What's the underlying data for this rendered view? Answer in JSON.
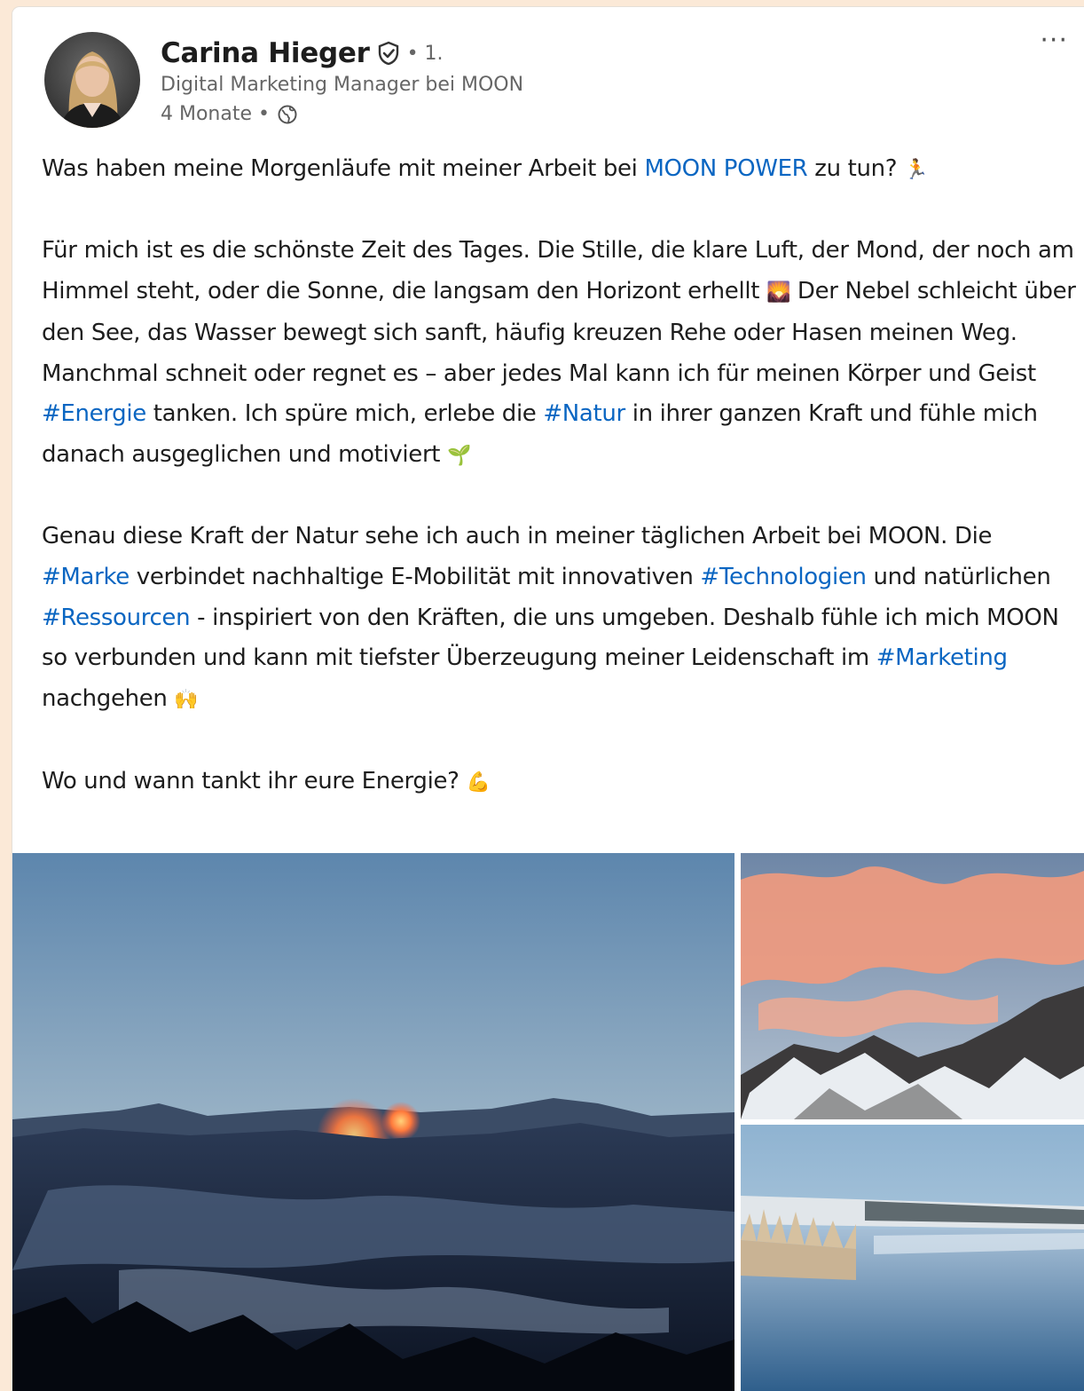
{
  "post": {
    "author": {
      "name": "Carina Hieger",
      "degree": "• 1.",
      "headline": "Digital Marketing Manager bei MOON",
      "time": "4 Monate •"
    },
    "more_label": "···",
    "paragraph1": {
      "before": "Was haben meine Morgenläufe mit meiner Arbeit bei ",
      "mention": "MOON POWER",
      "after": " zu tun? ",
      "emoji": "🏃"
    },
    "paragraph2": {
      "t1": "Für mich ist es die schönste Zeit des Tages. Die Stille, die klare Luft, der Mond, der noch am Himmel steht, oder die Sonne, die langsam den Horizont erhellt ",
      "emoji1": "🌄",
      "t2": "  Der Nebel schleicht über den See, das Wasser bewegt sich sanft, häufig kreuzen Rehe oder Hasen meinen Weg. Manchmal schneit oder regnet es – aber jedes Mal kann ich für meinen Körper und Geist ",
      "tag1": "#Energie",
      "t3": " tanken. Ich spüre mich, erlebe die ",
      "tag2": "#Natur",
      "t4": " in ihrer ganzen Kraft und fühle mich danach ausgeglichen und motiviert ",
      "emoji2": "🌱"
    },
    "paragraph3": {
      "t1": "Genau diese Kraft der Natur sehe ich auch in meiner täglichen Arbeit bei MOON. Die ",
      "tag1": "#Marke",
      "t2": " verbindet nachhaltige E-Mobilität mit innovativen ",
      "tag2": "#Technologien",
      "t3": " und natürlichen ",
      "tag3": "#Ressourcen",
      "t4": " - inspiriert von den Kräften, die uns umgeben. Deshalb fühle ich mich MOON so verbunden und kann mit tiefster Überzeugung meiner Leidenschaft im ",
      "tag4": "#Marketing",
      "t5": " nachgehen ",
      "emoji": "🙌"
    },
    "paragraph4": {
      "text": "Wo und wann tankt ihr eure Energie? ",
      "emoji": "💪"
    }
  },
  "colors": {
    "background": "#fbe9d7",
    "link": "#0a66c2",
    "text": "#1d1d1d",
    "secondary": "#666666"
  },
  "icons": {
    "verified": "shield-check-icon",
    "visibility": "globe-icon",
    "more": "more-horizontal-icon"
  }
}
